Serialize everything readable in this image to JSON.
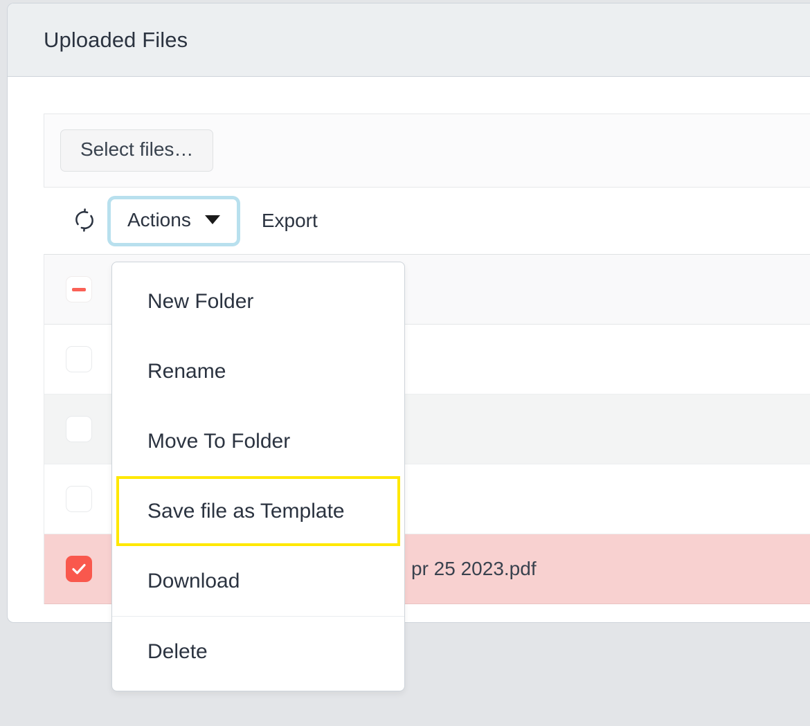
{
  "window": {
    "background_color": "#e3e5e8"
  },
  "card": {
    "header": {
      "title": "Uploaded Files"
    },
    "upload_panel": {
      "select_files_label": "Select files…"
    },
    "toolbar": {
      "refresh_icon": "refresh-icon",
      "actions_label": "Actions",
      "actions_caret_icon": "chevron-down-icon",
      "export_label": "Export",
      "actions_focus_ring_color": "#b8e0ee"
    }
  },
  "dropdown": {
    "items": [
      {
        "label": "New Folder",
        "highlighted": false
      },
      {
        "label": "Rename",
        "highlighted": false
      },
      {
        "label": "Move To Folder",
        "highlighted": false
      },
      {
        "label": "Save file as Template",
        "highlighted": true
      },
      {
        "label": "Download",
        "highlighted": false
      },
      {
        "label": "Delete",
        "highlighted": false
      }
    ],
    "highlight_color": "#ffe800",
    "separator_before_index": 5
  },
  "table": {
    "rows": [
      {
        "checkbox_state": "indeterminate",
        "name": "",
        "style": "head"
      },
      {
        "checkbox_state": "unchecked",
        "name": "",
        "style": "plain"
      },
      {
        "checkbox_state": "unchecked",
        "name": "",
        "style": "striped"
      },
      {
        "checkbox_state": "unchecked",
        "name": "",
        "style": "plain"
      },
      {
        "checkbox_state": "checked",
        "name": "pr 25 2023.pdf",
        "style": "selected"
      }
    ],
    "selected_row_color": "#f8d1d0",
    "checkbox_accent_color": "#f9584d"
  }
}
